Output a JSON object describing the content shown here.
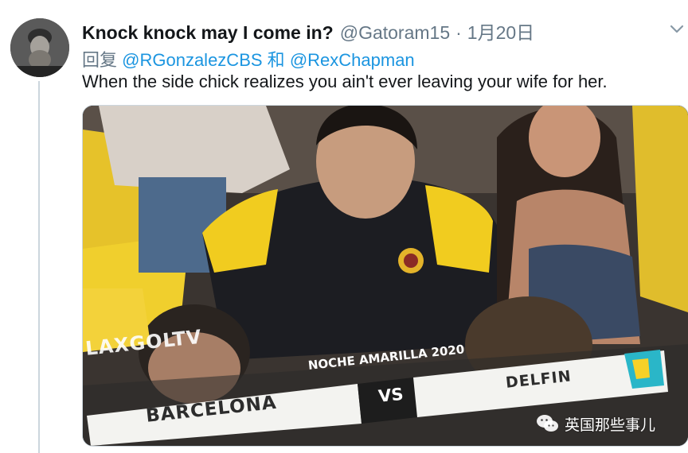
{
  "tweet": {
    "display_name": "Knock knock may I come in?",
    "handle": "@Gatoram15",
    "separator": "·",
    "date": "1月20日",
    "reply_prefix": "回复",
    "reply_to": [
      "@RGonzalezCBS",
      "@RexChapman"
    ],
    "reply_joiner": "和",
    "text": "When the side chick realizes you ain't ever leaving your wife for her.",
    "more_icon": "chevron-down-icon"
  },
  "media": {
    "channel": "LAXGOLTV",
    "event": "NOCHE AMARILLA 2020",
    "home_team": "BARCELONA",
    "vs": "VS",
    "away_team": "DELFIN"
  },
  "watermark": {
    "icon": "wechat-icon",
    "text": "英国那些事儿"
  },
  "colors": {
    "name": "#14171a",
    "secondary": "#657786",
    "mention": "#1b95e0",
    "jersey_yellow": "#f1cc1f",
    "jersey_black": "#1c1d22",
    "scoreboard_white": "#f3f3f0"
  }
}
